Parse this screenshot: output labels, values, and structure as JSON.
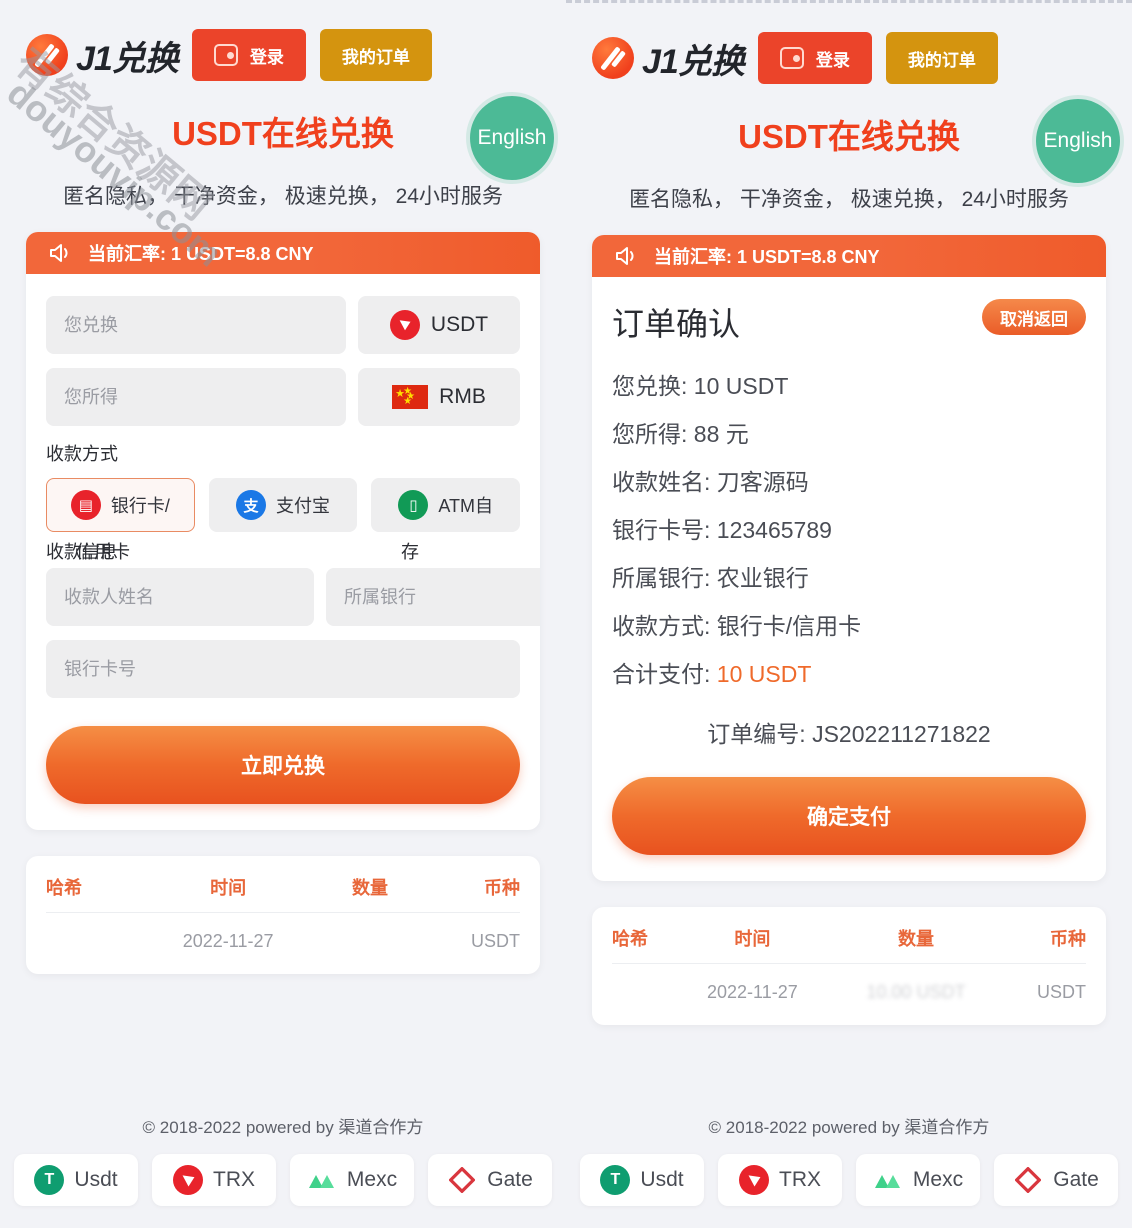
{
  "brand": {
    "name": "J1兑换",
    "logo_icon": "j1-logo-mark"
  },
  "header": {
    "login_label": "登录",
    "login_icon": "wallet-icon",
    "orders_label": "我的订单",
    "language_label": "English",
    "login_color": "#eb442a",
    "orders_color": "#d4940f",
    "language_color": "#4cba96"
  },
  "hero": {
    "title": "USDT在线兑换",
    "title_color": "#f0401d",
    "subtitle": "匿名隐私， 干净资金， 极速兑换， 24小时服务"
  },
  "rate": {
    "icon": "speaker-icon",
    "text": "当前汇率: 1 USDT=8.8 CNY",
    "banner_color": "#f2673a"
  },
  "exchange_form": {
    "pay_placeholder": "您兑换",
    "pay_currency": "USDT",
    "pay_currency_icon": "tron-icon",
    "receive_placeholder": "您所得",
    "receive_currency": "RMB",
    "receive_currency_icon": "china-flag-icon",
    "method_label": "收款方式",
    "methods": [
      {
        "label": "银行卡/信用卡",
        "short": "银行卡/",
        "overflow": "信用卡",
        "icon": "bank-card-icon",
        "selected": true
      },
      {
        "label": "支付宝",
        "short": "支付宝",
        "overflow": "",
        "icon": "alipay-icon",
        "selected": false
      },
      {
        "label": "ATM自存",
        "short": "ATM自",
        "overflow": "存",
        "icon": "atm-icon",
        "selected": false
      }
    ],
    "info_label": "收款信息",
    "payee_name_placeholder": "收款人姓名",
    "bank_placeholder": "所属银行",
    "card_no_placeholder": "银行卡号",
    "submit_label": "立即兑换"
  },
  "order_confirm": {
    "title": "订单确认",
    "cancel_label": "取消返回",
    "lines": [
      {
        "label": "您兑换:",
        "value": "10 USDT",
        "highlight": false
      },
      {
        "label": "您所得:",
        "value": "88 元",
        "highlight": false
      },
      {
        "label": "收款姓名:",
        "value": "刀客源码",
        "highlight": false
      },
      {
        "label": "银行卡号:",
        "value": "123465789",
        "highlight": false
      },
      {
        "label": "所属银行:",
        "value": "农业银行",
        "highlight": false
      },
      {
        "label": "收款方式:",
        "value": "银行卡/信用卡",
        "highlight": false
      },
      {
        "label": "合计支付:",
        "value": "10 USDT",
        "highlight": true
      }
    ],
    "order_no_label": "订单编号:",
    "order_no": "JS202211271822",
    "confirm_label": "确定支付",
    "highlight_color": "#ef6a2b"
  },
  "tx_table": {
    "headers": [
      "哈希",
      "时间",
      "数量",
      "币种"
    ],
    "header_color": "#e8673a",
    "rows_left": [
      {
        "hash": "",
        "time": "2022-11-27",
        "amount": "",
        "coin": "USDT",
        "blurred_amount": ""
      }
    ],
    "rows_right": [
      {
        "hash": "",
        "time": "2022-11-27",
        "amount": "",
        "coin": "USDT",
        "blurred_amount": "10.00 USDT"
      }
    ]
  },
  "footer": {
    "copyright": "© 2018-2022 powered by 渠道合作方",
    "coins": [
      {
        "label": "Usdt",
        "icon": "usdt-icon",
        "color": "#0f9d70"
      },
      {
        "label": "TRX",
        "icon": "tron-icon",
        "color": "#e8232b"
      },
      {
        "label": "Mexc",
        "icon": "mexc-icon",
        "color": "#3fd18a"
      },
      {
        "label": "Gate",
        "icon": "gate-icon",
        "color": "#d9363e"
      }
    ]
  },
  "watermark": {
    "line1": "有综合资源网",
    "line2": "douyouvip.com"
  }
}
